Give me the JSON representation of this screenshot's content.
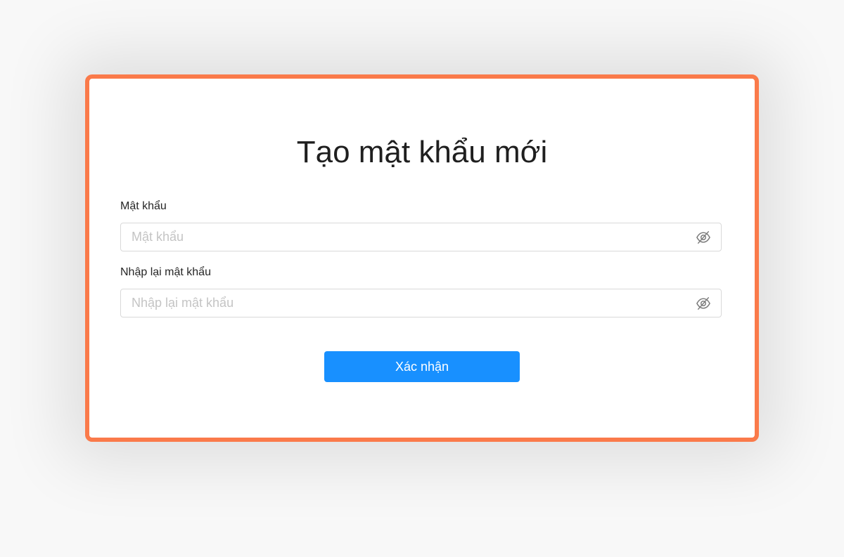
{
  "form": {
    "title": "Tạo mật khẩu mới",
    "password": {
      "label": "Mật khẩu",
      "placeholder": "Mật khẩu",
      "value": "",
      "toggle_icon": "eye-off-icon"
    },
    "confirm_password": {
      "label": "Nhập lại mật khẩu",
      "placeholder": "Nhập lại mật khẩu",
      "value": "",
      "toggle_icon": "eye-off-icon"
    },
    "submit_label": "Xác nhận"
  },
  "colors": {
    "accent": "#1890ff",
    "frame_border": "#fa7a4a",
    "background": "#f8f8f8"
  }
}
